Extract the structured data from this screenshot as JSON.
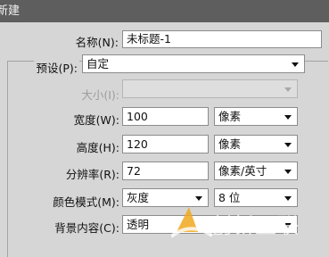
{
  "window": {
    "title": "新建"
  },
  "form": {
    "name": {
      "label": "名称(N):",
      "value": "未标题-1"
    },
    "preset": {
      "label": "预设(P):",
      "value": "自定"
    },
    "size": {
      "label": "大小(I):",
      "value": ""
    },
    "width": {
      "label": "宽度(W):",
      "value": "100",
      "unit": "像素"
    },
    "height": {
      "label": "高度(H):",
      "value": "120",
      "unit": "像素"
    },
    "resolution": {
      "label": "分辨率(R):",
      "value": "72",
      "unit": "像素/英寸"
    },
    "color_mode": {
      "label": "颜色模式(M):",
      "value": "灰度",
      "bits": "8 位"
    },
    "background": {
      "label": "背景内容(C):",
      "value": "透明"
    }
  },
  "watermark": {
    "text": "创新互联"
  },
  "colors": {
    "titlebar": "#5e5e5e",
    "dialog_bg": "#d6d6d6",
    "watermark_accent": "#f0a81e"
  }
}
